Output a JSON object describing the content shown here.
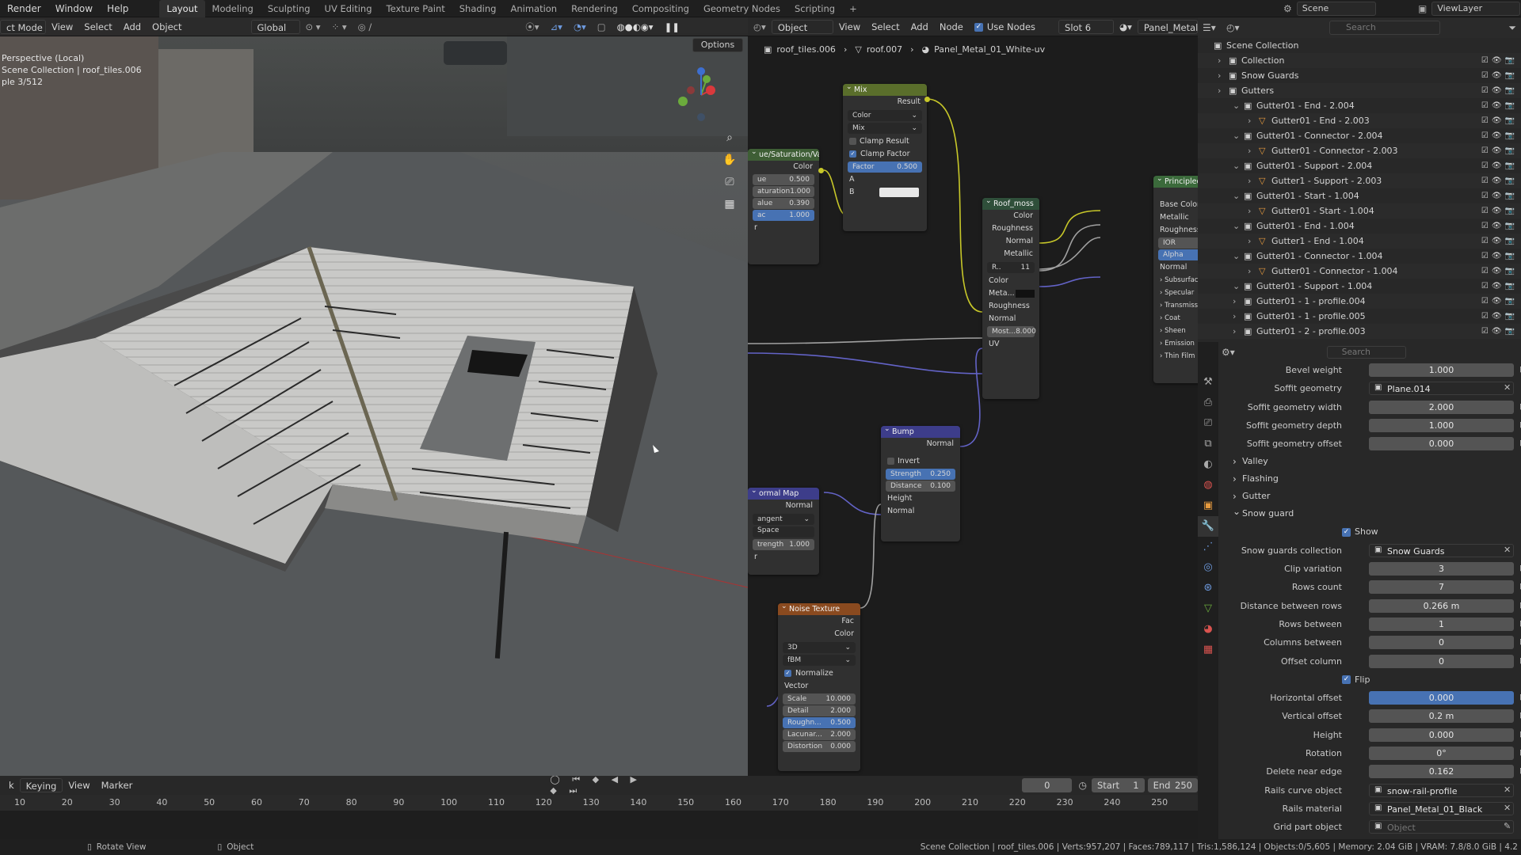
{
  "topbar": {
    "menus": [
      "Render",
      "Window",
      "Help"
    ],
    "workspaces": [
      "Layout",
      "Modeling",
      "Sculpting",
      "UV Editing",
      "Texture Paint",
      "Shading",
      "Animation",
      "Rendering",
      "Compositing",
      "Geometry Nodes",
      "Scripting"
    ],
    "active_workspace": "Layout",
    "add_tab": "+",
    "scene": "Scene",
    "view_layer": "ViewLayer"
  },
  "viewport": {
    "mode": "ct Mode",
    "menus": [
      "View",
      "Select",
      "Add",
      "Object"
    ],
    "transform_orientation": "Global",
    "options_label": "Options",
    "overlay_text": {
      "perspective": "Perspective (Local)",
      "collection": "Scene Collection | roof_tiles.006",
      "sample": "ple 3/512"
    },
    "gizmo_axes": [
      "X",
      "Y",
      "Z"
    ]
  },
  "node_editor": {
    "header": {
      "object_mode": "Object",
      "menus": [
        "View",
        "Select",
        "Add",
        "Node"
      ],
      "use_nodes_label": "Use Nodes",
      "slot": "Slot 6",
      "material": "Panel_Metal_"
    },
    "breadcrumb": [
      "roof_tiles.006",
      "roof.007",
      "Panel_Metal_01_White-uv"
    ],
    "nodes": {
      "hsv": {
        "title": "ue/Saturation/Value",
        "out": "Color",
        "hue_label": "ue",
        "hue": "0.500",
        "sat_label": "aturation",
        "sat": "1.000",
        "val_label": "alue",
        "val": "0.390",
        "fac_label": "ac",
        "fac": "1.000",
        "color_label": "r"
      },
      "mix": {
        "title": "Mix",
        "out": "Result",
        "type": "Color",
        "blend": "Mix",
        "clamp_result": "Clamp Result",
        "clamp_factor": "Clamp Factor",
        "factor_label": "Factor",
        "factor": "0.500",
        "a": "A",
        "b": "B"
      },
      "roof_moss": {
        "title": "Roof_moss",
        "out_color": "Color",
        "out_rough": "Roughness",
        "out_normal": "Normal",
        "out_metal": "Metallic",
        "img_name": "R..",
        "users": "11",
        "in_color": "Color",
        "in_meta": "Meta...",
        "in_rough": "Roughness",
        "in_normal": "Normal",
        "most_label": "Most...",
        "most": "8.000",
        "in_uv": "UV"
      },
      "principled": {
        "title": "Principled",
        "inputs": [
          "Base Color",
          "Metallic",
          "Roughness",
          "IOR",
          "Alpha",
          "Normal"
        ],
        "sections": [
          "Subsurfac",
          "Specular",
          "Transmiss",
          "Coat",
          "Sheen",
          "Emission",
          "Thin Film"
        ]
      },
      "bump": {
        "title": "Bump",
        "out": "Normal",
        "invert": "Invert",
        "strength_label": "Strength",
        "strength": "0.250",
        "distance_label": "Distance",
        "distance": "0.100",
        "height": "Height",
        "normal": "Normal"
      },
      "normal_map": {
        "title": "ormal Map",
        "out": "Normal",
        "space": "angent Space",
        "strength_label": "trength",
        "strength": "1.000",
        "color_label": "r"
      },
      "noise": {
        "title": "Noise Texture",
        "out_fac": "Fac",
        "out_color": "Color",
        "dims": "3D",
        "type": "fBM",
        "normalize": "Normalize",
        "vector": "Vector",
        "fields": [
          {
            "label": "Scale",
            "value": "10.000"
          },
          {
            "label": "Detail",
            "value": "2.000"
          },
          {
            "label": "Roughn...",
            "value": "0.500"
          },
          {
            "label": "Lacunar...",
            "value": "2.000"
          },
          {
            "label": "Distortion",
            "value": "0.000"
          }
        ]
      }
    }
  },
  "outliner": {
    "search_placeholder": "Search",
    "rows": [
      {
        "label": "Scene Collection",
        "indent": 0
      },
      {
        "label": "Collection",
        "indent": 1
      },
      {
        "label": "Snow Guards",
        "indent": 1
      },
      {
        "label": "Gutters",
        "indent": 1
      },
      {
        "label": "Gutter01 - End - 2.004",
        "indent": 2
      },
      {
        "label": "Gutter01 - End - 2.003",
        "indent": 3
      },
      {
        "label": "Gutter01 - Connector - 2.004",
        "indent": 2
      },
      {
        "label": "Gutter01 - Connector - 2.003",
        "indent": 3
      },
      {
        "label": "Gutter01 - Support - 2.004",
        "indent": 2
      },
      {
        "label": "Gutter1 - Support - 2.003",
        "indent": 3
      },
      {
        "label": "Gutter01 - Start - 1.004",
        "indent": 2
      },
      {
        "label": "Gutter01 - Start - 1.004",
        "indent": 3
      },
      {
        "label": "Gutter01 - End - 1.004",
        "indent": 2
      },
      {
        "label": "Gutter1 - End - 1.004",
        "indent": 3
      },
      {
        "label": "Gutter01 - Connector - 1.004",
        "indent": 2
      },
      {
        "label": "Gutter01 - Connector - 1.004",
        "indent": 3
      },
      {
        "label": "Gutter01 - Support - 1.004",
        "indent": 2
      },
      {
        "label": "Gutter01 - 1 - profile.004",
        "indent": 2
      },
      {
        "label": "Gutter01 - 1 - profile.005",
        "indent": 2
      },
      {
        "label": "Gutter01 - 2 - profile.003",
        "indent": 2
      }
    ]
  },
  "properties": {
    "search_placeholder": "Search",
    "top_fields": [
      {
        "label": "Bevel weight",
        "value": "1.000"
      },
      {
        "label": "Soffit geometry",
        "value": "Plane.014",
        "object": true
      },
      {
        "label": "Soffit geometry width",
        "value": "2.000"
      },
      {
        "label": "Soffit geometry depth",
        "value": "1.000"
      },
      {
        "label": "Soffit geometry offset",
        "value": "0.000"
      }
    ],
    "sections": [
      "Valley",
      "Flashing",
      "Gutter",
      "Snow guard"
    ],
    "show_label": "Show",
    "snow_fields": [
      {
        "label": "Snow guards collection",
        "value": "Snow Guards",
        "object": true
      },
      {
        "label": "Clip variation",
        "value": "3"
      },
      {
        "label": "Rows count",
        "value": "7"
      },
      {
        "label": "Distance between rows",
        "value": "0.266 m"
      },
      {
        "label": "Rows between",
        "value": "1"
      },
      {
        "label": "Columns between",
        "value": "0"
      },
      {
        "label": "Offset column",
        "value": "0"
      }
    ],
    "flip_label": "Flip",
    "flip_fields": [
      {
        "label": "Horizontal offset",
        "value": "0.000",
        "blue": true
      },
      {
        "label": "Vertical offset",
        "value": "0.2 m"
      },
      {
        "label": "Height",
        "value": "0.000"
      },
      {
        "label": "Rotation",
        "value": "0°"
      },
      {
        "label": "Delete near edge",
        "value": "0.162"
      },
      {
        "label": "Rails curve object",
        "value": "snow-rail-profile",
        "object": true
      },
      {
        "label": "Rails material",
        "value": "Panel_Metal_01_Black",
        "object": true
      },
      {
        "label": "Grid part object",
        "value": "Object",
        "object": true,
        "placeholder": true
      }
    ]
  },
  "timeline": {
    "menus": [
      "k",
      "Keying",
      "View",
      "Marker"
    ],
    "current_frame": "0",
    "start_label": "Start",
    "start": "1",
    "end_label": "End",
    "end": "250",
    "ticks": [
      "10",
      "20",
      "30",
      "40",
      "50",
      "60",
      "70",
      "80",
      "90",
      "100",
      "110",
      "120",
      "130",
      "140",
      "150",
      "160",
      "170",
      "180",
      "190",
      "200",
      "210",
      "220",
      "230",
      "240",
      "250"
    ]
  },
  "statusbar": {
    "left": "Rotate View",
    "mid": "Object",
    "right": "Scene Collection | roof_tiles.006 | Verts:957,207 | Faces:789,117 | Tris:1,586,124 | Objects:0/5,605 | Memory: 2.04 GiB | VRAM: 7.8/8.0 GiB | 4.2"
  },
  "colors": {
    "accent": "#4772b3",
    "header": "#303030",
    "socket_yellow": "#c7c729",
    "socket_purple": "#6363c7"
  }
}
